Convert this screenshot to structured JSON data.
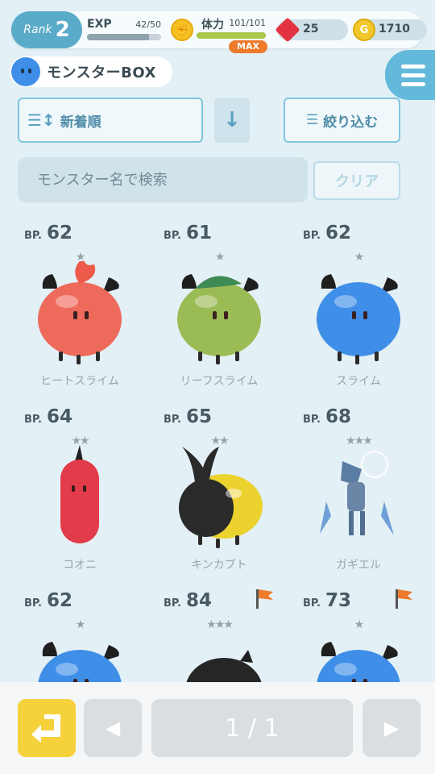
{
  "status": {
    "rank_label": "Rank",
    "rank_value": "2",
    "exp_label": "EXP",
    "exp_value": "42/50",
    "exp_progress": 0.84,
    "stamina_label": "体力",
    "stamina_value": "101/101",
    "stamina_progress": 1.0,
    "stamina_badge": "MAX",
    "gems": "25",
    "gold": "1710"
  },
  "header": {
    "title": "モンスターBOX"
  },
  "controls": {
    "sort_label": "新着順",
    "sort_direction_icon": "↓",
    "filter_label": "絞り込む",
    "search_placeholder": "モンスター名で検索",
    "clear_label": "クリア"
  },
  "monsters": [
    {
      "bp_label": "BP.",
      "bp": "62",
      "stars": 1,
      "name": "ヒートスライム",
      "flag": false,
      "art": "heat-slime",
      "color": "#ee6b5c"
    },
    {
      "bp_label": "BP.",
      "bp": "61",
      "stars": 1,
      "name": "リーフスライム",
      "flag": false,
      "art": "leaf-slime",
      "color": "#9bbb55"
    },
    {
      "bp_label": "BP.",
      "bp": "62",
      "stars": 1,
      "name": "スライム",
      "flag": false,
      "art": "slime",
      "color": "#3f8fe8"
    },
    {
      "bp_label": "BP.",
      "bp": "64",
      "stars": 2,
      "name": "コオニ",
      "flag": false,
      "art": "kooni",
      "color": "#e23b4a"
    },
    {
      "bp_label": "BP.",
      "bp": "65",
      "stars": 2,
      "name": "キンカブト",
      "flag": false,
      "art": "kinkabuto",
      "color": "#ecd22e"
    },
    {
      "bp_label": "BP.",
      "bp": "68",
      "stars": 3,
      "name": "ガギエル",
      "flag": false,
      "art": "gagiel",
      "color": "#6f9fd6"
    },
    {
      "bp_label": "BP.",
      "bp": "62",
      "stars": 1,
      "name": "",
      "flag": false,
      "art": "slime",
      "color": "#3f8fe8"
    },
    {
      "bp_label": "BP.",
      "bp": "84",
      "stars": 3,
      "name": "",
      "flag": true,
      "art": "black-beast",
      "color": "#262626"
    },
    {
      "bp_label": "BP.",
      "bp": "73",
      "stars": 1,
      "name": "",
      "flag": true,
      "art": "slime",
      "color": "#3f8fe8"
    }
  ],
  "pagination": {
    "page_text": "1 / 1",
    "prev_icon": "◀",
    "next_icon": "▶"
  },
  "colors": {
    "background": "#e3f0f5",
    "accent": "#5aaac9",
    "back_button": "#f5d13b",
    "max_badge": "#ee7a2c"
  }
}
